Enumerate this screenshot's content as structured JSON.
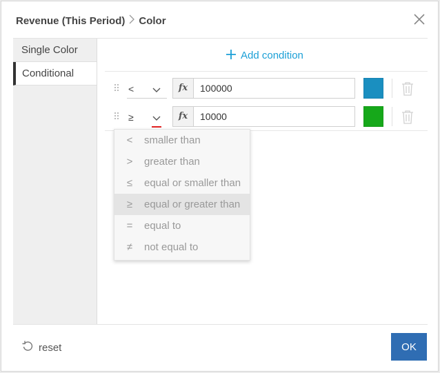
{
  "header": {
    "breadcrumb_parent": "Revenue (This Period)",
    "breadcrumb_current": "Color"
  },
  "sidebar": {
    "items": [
      {
        "label": "Single Color"
      },
      {
        "label": "Conditional"
      }
    ],
    "active": "Conditional"
  },
  "main": {
    "add_condition_label": "Add condition",
    "conditions": [
      {
        "operator": "<",
        "value": "100000",
        "color": "#1a8fc0"
      },
      {
        "operator": "≥",
        "value": "10000",
        "color": "#16a81a"
      }
    ],
    "fx_label": "fx"
  },
  "operator_dropdown": {
    "options": [
      {
        "symbol": "<",
        "label": "smaller than"
      },
      {
        "symbol": ">",
        "label": "greater than"
      },
      {
        "symbol": "≤",
        "label": "equal or smaller than"
      },
      {
        "symbol": "≥",
        "label": "equal or greater than"
      },
      {
        "symbol": "=",
        "label": "equal to"
      },
      {
        "symbol": "≠",
        "label": "not equal to"
      }
    ],
    "highlighted": "equal or greater than"
  },
  "footer": {
    "reset_label": "reset",
    "ok_label": "OK"
  },
  "colors": {
    "accent": "#1a9fd6",
    "primary_button": "#2f6db3",
    "error_underline": "#e02020"
  },
  "icons": {
    "close": "close-icon",
    "breadcrumb_separator": "chevron-right-icon",
    "add": "plus-icon",
    "drag": "drag-handle-icon",
    "dropdown": "chevron-down-icon",
    "delete": "trash-icon",
    "reset": "undo-icon"
  }
}
